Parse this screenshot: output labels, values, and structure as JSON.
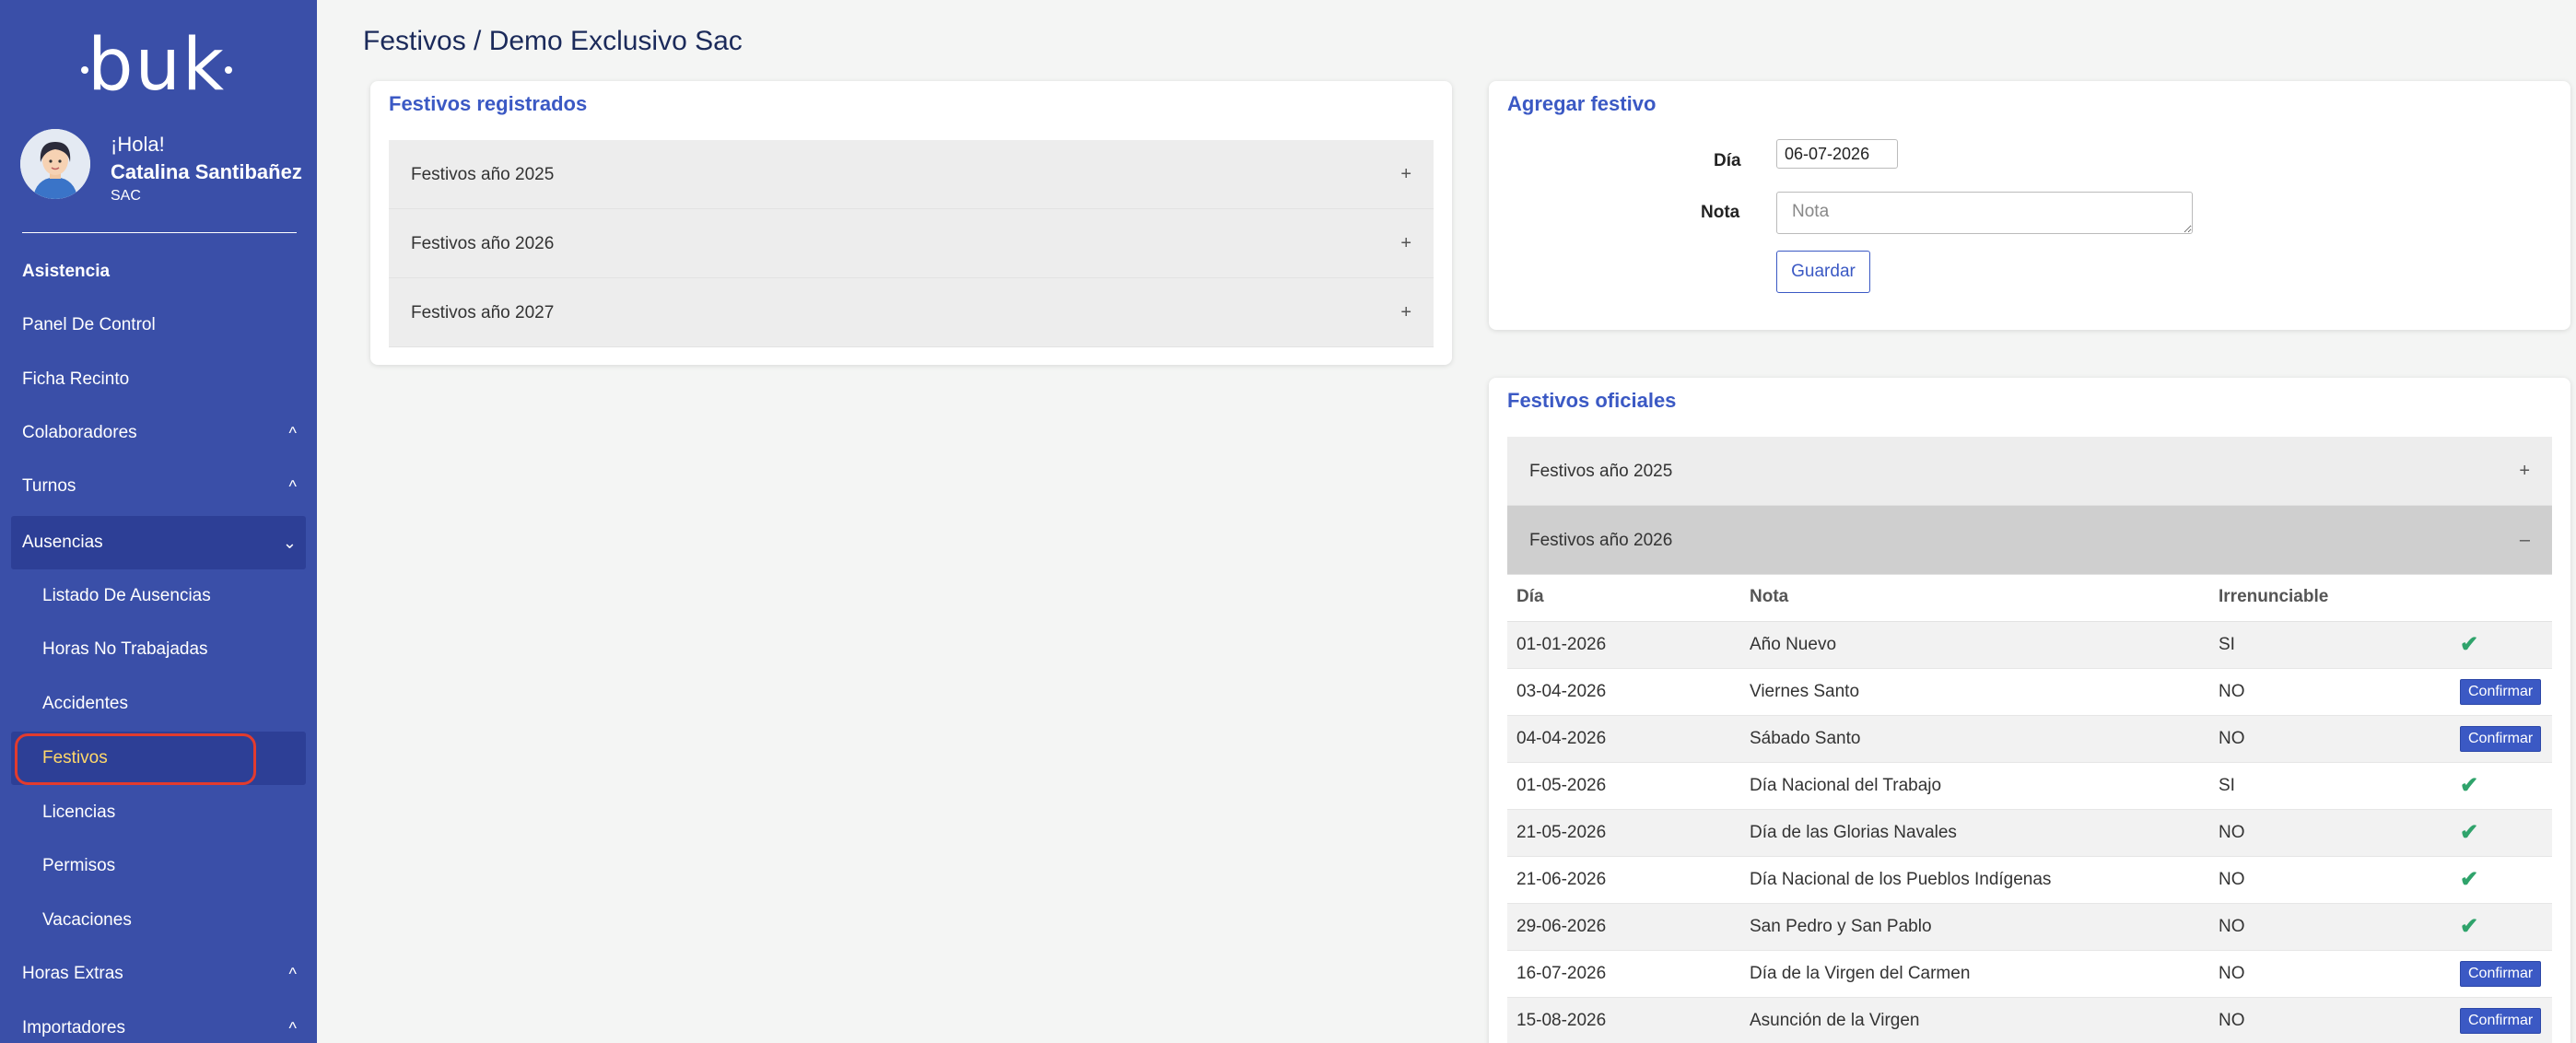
{
  "sidebar": {
    "logo": "buk",
    "greeting": "¡Hola!",
    "user_name": "Catalina Santibañez",
    "user_role": "SAC",
    "items": [
      {
        "label": "Asistencia"
      },
      {
        "label": "Panel De Control"
      },
      {
        "label": "Ficha Recinto"
      },
      {
        "label": "Colaboradores"
      },
      {
        "label": "Turnos"
      },
      {
        "label": "Ausencias"
      },
      {
        "label": "Listado De Ausencias"
      },
      {
        "label": "Horas No Trabajadas"
      },
      {
        "label": "Accidentes"
      },
      {
        "label": "Festivos"
      },
      {
        "label": "Licencias"
      },
      {
        "label": "Permisos"
      },
      {
        "label": "Vacaciones"
      },
      {
        "label": "Horas Extras"
      },
      {
        "label": "Importadores"
      }
    ],
    "chevron_up": "^",
    "chevron_down": "⌄"
  },
  "page": {
    "title": "Festivos / Demo Exclusivo Sac"
  },
  "registered": {
    "title": "Festivos registrados",
    "years": [
      {
        "label": "Festivos año 2025",
        "toggle": "+"
      },
      {
        "label": "Festivos año 2026",
        "toggle": "+"
      },
      {
        "label": "Festivos año 2027",
        "toggle": "+"
      }
    ]
  },
  "add_form": {
    "title": "Agregar festivo",
    "day_label": "Día",
    "day_value": "06-07-2026",
    "note_label": "Nota",
    "note_placeholder": "Nota",
    "save_label": "Guardar"
  },
  "official": {
    "title": "Festivos oficiales",
    "years": [
      {
        "label": "Festivos año 2025",
        "toggle": "+"
      },
      {
        "label": "Festivos año 2026",
        "toggle": "–"
      }
    ],
    "columns": [
      "Día",
      "Nota",
      "Irrenunciable"
    ],
    "rows": [
      {
        "day": "01-01-2026",
        "note": "Año Nuevo",
        "irr": "SI",
        "confirm": ""
      },
      {
        "day": "03-04-2026",
        "note": "Viernes Santo",
        "irr": "NO",
        "confirm": "Confirmar"
      },
      {
        "day": "04-04-2026",
        "note": "Sábado Santo",
        "irr": "NO",
        "confirm": "Confirmar"
      },
      {
        "day": "01-05-2026",
        "note": "Día Nacional del Trabajo",
        "irr": "SI",
        "confirm": ""
      },
      {
        "day": "21-05-2026",
        "note": "Día de las Glorias Navales",
        "irr": "NO",
        "confirm": ""
      },
      {
        "day": "21-06-2026",
        "note": "Día Nacional de los Pueblos Indígenas",
        "irr": "NO",
        "confirm": ""
      },
      {
        "day": "29-06-2026",
        "note": "San Pedro y San Pablo",
        "irr": "NO",
        "confirm": ""
      },
      {
        "day": "16-07-2026",
        "note": "Día de la Virgen del Carmen",
        "irr": "NO",
        "confirm": "Confirmar"
      },
      {
        "day": "15-08-2026",
        "note": "Asunción de la Virgen",
        "irr": "NO",
        "confirm": "Confirmar"
      }
    ],
    "check_mark": "✔"
  }
}
